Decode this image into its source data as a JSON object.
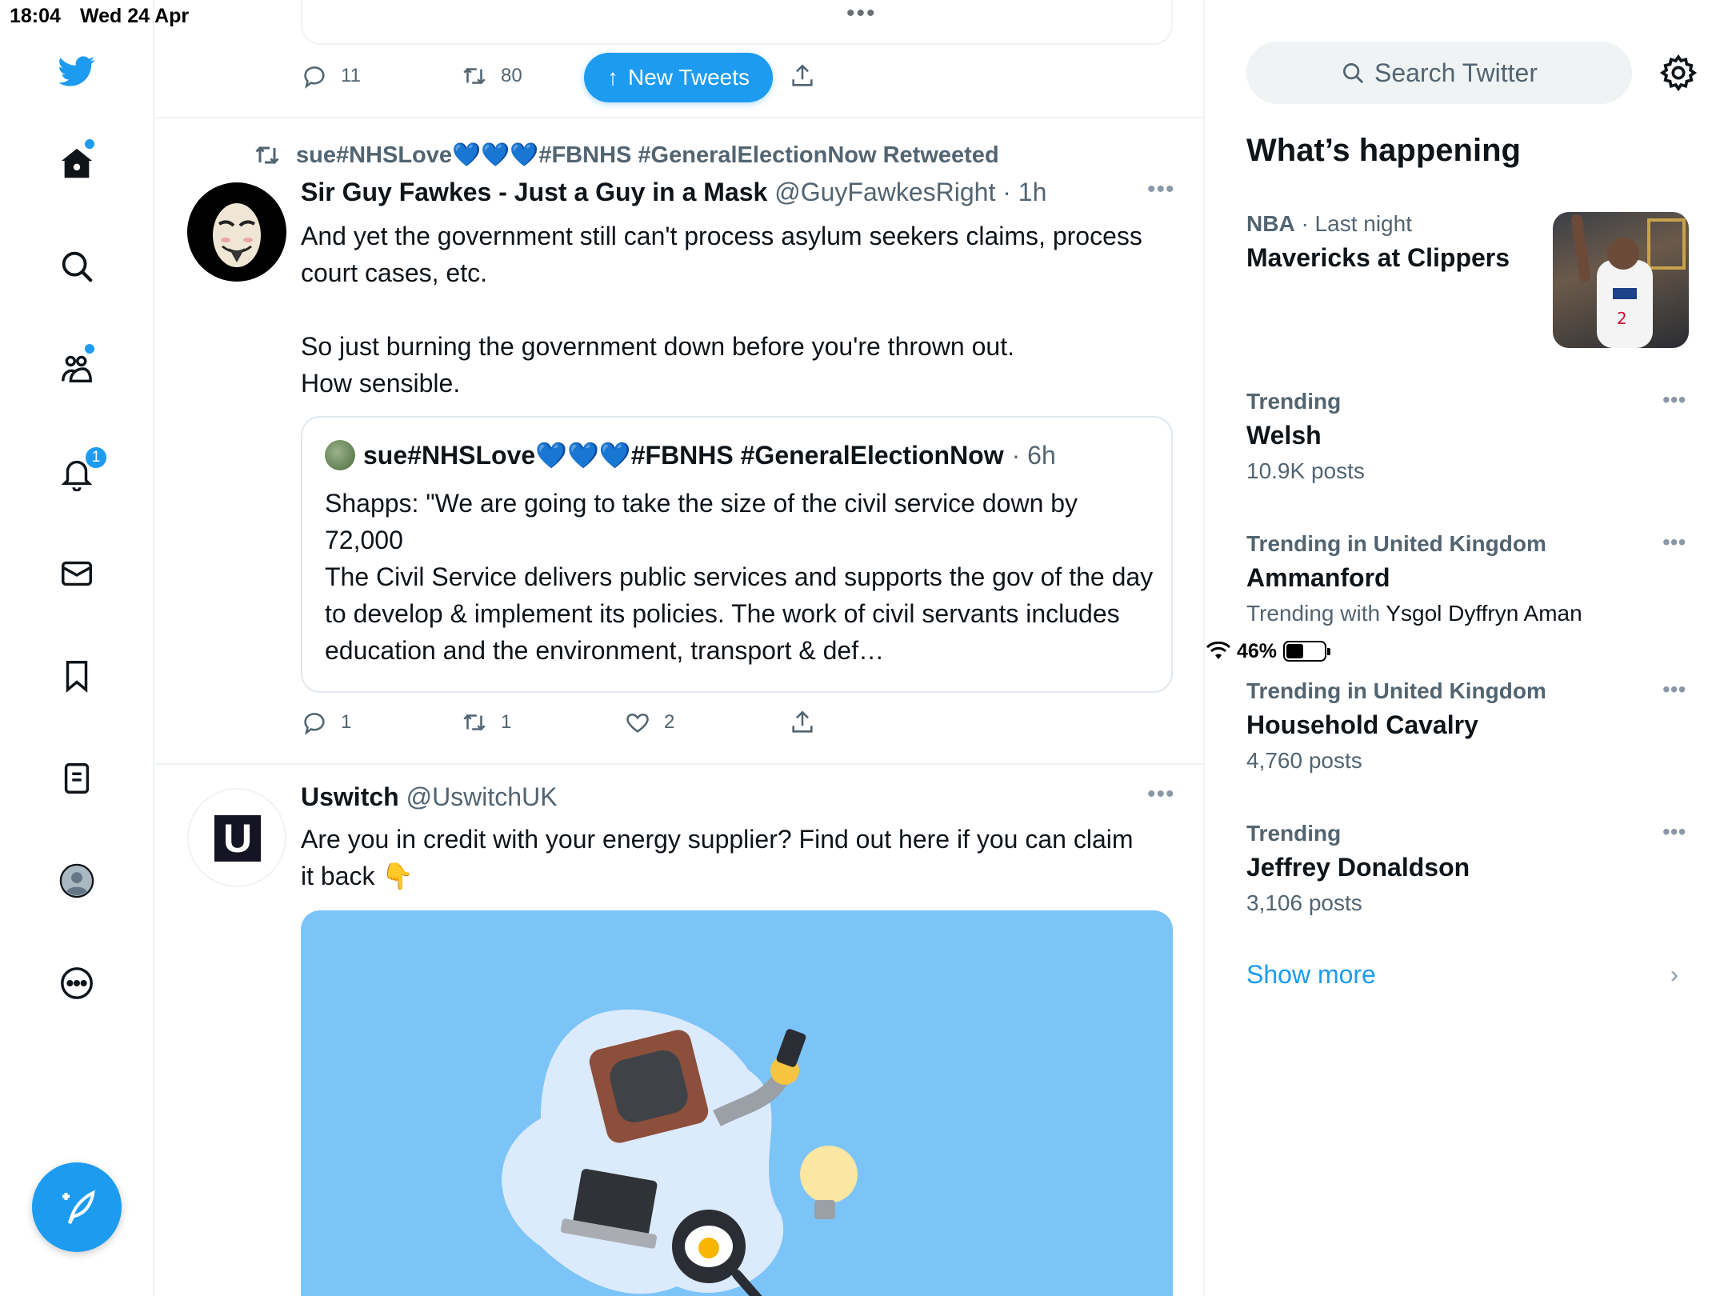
{
  "status_bar": {
    "time": "18:04",
    "date": "Wed 24 Apr",
    "battery": "46%",
    "battery_level": 0.46
  },
  "nav": {
    "notification_count": "1",
    "icons": [
      "twitter-logo-icon",
      "home-icon",
      "search-icon",
      "communities-icon",
      "notifications-icon",
      "messages-icon",
      "bookmarks-icon",
      "lists-icon",
      "profile-icon",
      "more-icon",
      "compose-icon"
    ]
  },
  "colors": {
    "accent": "#1d9bf0",
    "text": "#0f1419",
    "secondary": "#536471",
    "border": "#eff3f4",
    "media_bg": "#7cc4f8"
  },
  "feed": {
    "prev_tweet": {
      "replies": "11",
      "retweets": "80"
    },
    "new_tweets_label": "New Tweets",
    "tweet1": {
      "retweeted_by": "sue#NHSLove💙💙💙#FBNHS #GeneralElectionNow Retweeted",
      "name": "Sir Guy Fawkes - Just a Guy in a Mask",
      "handle": "@GuyFawkesRight",
      "time": "· 1h",
      "text": "And yet the government still can't process asylum seekers claims, process court cases, etc.\n\nSo just burning the government down before you're thrown out.\nHow sensible.",
      "quote": {
        "name": "sue#NHSLove💙💙💙#FBNHS #GeneralElectionNow",
        "time": "· 6h",
        "text": "Shapps: \"We are going to take the size of the civil service down by 72,000\nThe Civil Service delivers public services and supports the gov of the day to develop & implement its policies. The work of civil servants includes education and the environment, transport & def…"
      },
      "replies": "1",
      "retweets": "1",
      "likes": "2"
    },
    "tweet2": {
      "name": "Uswitch",
      "handle": "@UswitchUK",
      "avatar_letter": "U",
      "text": "Are you in credit with your energy supplier? Find out here if you can claim it back 👇"
    }
  },
  "sidebar": {
    "search_placeholder": "Search Twitter",
    "heading": "What’s happening",
    "trends": [
      {
        "meta_bold": "NBA",
        "meta": "· Last night",
        "title": "Mavericks at Clippers"
      },
      {
        "meta": "Trending",
        "title": "Welsh",
        "sub": "10.9K posts"
      },
      {
        "meta": "Trending in United Kingdom",
        "title": "Ammanford",
        "sub_prefix": "Trending with",
        "sub_link": "Ysgol Dyffryn Aman"
      },
      {
        "meta": "Trending in United Kingdom",
        "title": "Household Cavalry",
        "sub": "4,760 posts"
      },
      {
        "meta": "Trending",
        "title": "Jeffrey Donaldson",
        "sub": "3,106 posts"
      }
    ],
    "show_more": "Show more"
  }
}
